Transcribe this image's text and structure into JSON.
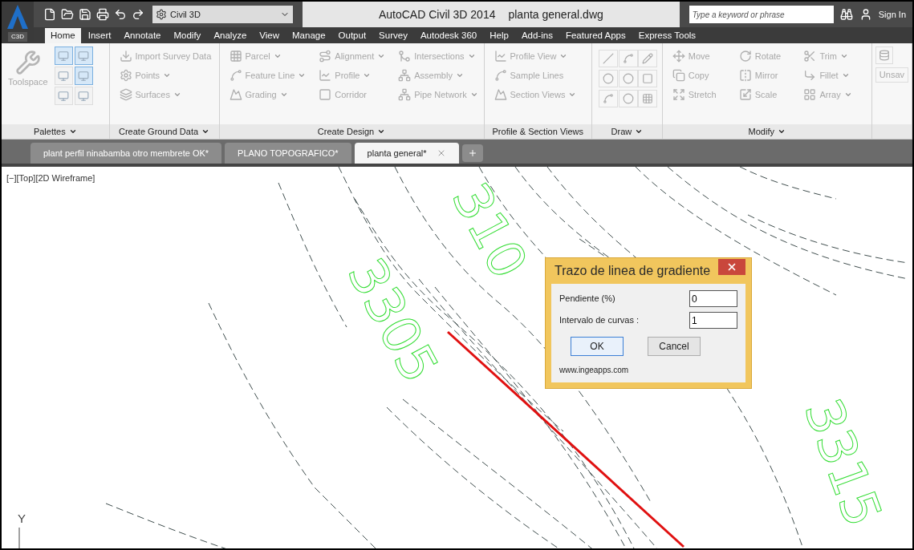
{
  "app": {
    "badge": "C3D"
  },
  "title_bar": {
    "workspace": "Civil 3D",
    "title": "AutoCAD Civil 3D 2014",
    "file": "planta general.dwg",
    "search": {
      "placeholder": "Type a keyword or phrase"
    },
    "sign_in": "Sign In"
  },
  "ribbon_tabs": [
    {
      "label": "Home",
      "selected": true
    },
    {
      "label": "Insert",
      "selected": false
    },
    {
      "label": "Annotate",
      "selected": false
    },
    {
      "label": "Modify",
      "selected": false
    },
    {
      "label": "Analyze",
      "selected": false
    },
    {
      "label": "View",
      "selected": false
    },
    {
      "label": "Manage",
      "selected": false
    },
    {
      "label": "Output",
      "selected": false
    },
    {
      "label": "Survey",
      "selected": false
    },
    {
      "label": "Autodesk 360",
      "selected": false
    },
    {
      "label": "Help",
      "selected": false
    },
    {
      "label": "Add-ins",
      "selected": false
    },
    {
      "label": "Featured Apps",
      "selected": false
    },
    {
      "label": "Express Tools",
      "selected": false
    }
  ],
  "ribbon_panels": [
    {
      "kind": "palettes",
      "title": "Palettes",
      "dropdown": true,
      "tools": [
        {
          "label": "Toolspace"
        }
      ]
    },
    {
      "kind": "list",
      "title": "Create Ground Data",
      "dropdown": true,
      "tools": [
        {
          "label": "Import Survey Data",
          "dropdown": false
        },
        {
          "label": "Points",
          "dropdown": true
        },
        {
          "label": "Surfaces",
          "dropdown": true
        }
      ]
    },
    {
      "kind": "list",
      "title": "Create Design",
      "dropdown": true,
      "tools": [
        {
          "label": "Parcel",
          "dropdown": true
        },
        {
          "label": "Feature Line",
          "dropdown": true
        },
        {
          "label": "Grading",
          "dropdown": true
        },
        {
          "label": "Alignment",
          "dropdown": true
        },
        {
          "label": "Profile",
          "dropdown": true
        },
        {
          "label": "Corridor",
          "dropdown": false
        },
        {
          "label": "Intersections",
          "dropdown": true
        },
        {
          "label": "Assembly",
          "dropdown": true
        },
        {
          "label": "Pipe Network",
          "dropdown": true
        }
      ]
    },
    {
      "kind": "list",
      "title": "Profile & Section Views",
      "dropdown": false,
      "tools": [
        {
          "label": "Profile View",
          "dropdown": true
        },
        {
          "label": "Sample Lines",
          "dropdown": false
        },
        {
          "label": "Section Views",
          "dropdown": true
        }
      ]
    },
    {
      "kind": "draw",
      "title": "Draw",
      "dropdown": true
    },
    {
      "kind": "list",
      "title": "Modify",
      "dropdown": true,
      "tools": [
        {
          "label": "Move",
          "dropdown": false
        },
        {
          "label": "Copy",
          "dropdown": false
        },
        {
          "label": "Stretch",
          "dropdown": false
        },
        {
          "label": "Rotate",
          "dropdown": false
        },
        {
          "label": "Mirror",
          "dropdown": false
        },
        {
          "label": "Scale",
          "dropdown": false
        },
        {
          "label": "Trim",
          "dropdown": true
        },
        {
          "label": "Fillet",
          "dropdown": true
        },
        {
          "label": "Array",
          "dropdown": true
        }
      ]
    },
    {
      "kind": "cut",
      "tools": [
        {
          "label": "Unsav"
        }
      ]
    }
  ],
  "doc_tabs": [
    {
      "label": "plant perfil ninabamba otro membrete OK*",
      "selected": false
    },
    {
      "label": "PLANO TOPOGRAFICO*",
      "selected": false
    },
    {
      "label": "planta general*",
      "selected": true
    }
  ],
  "viewport": {
    "label": "[−][Top][2D Wireframe]",
    "contour_labels": [
      "3305",
      "310",
      "3315"
    ],
    "axis_label": "Y"
  },
  "dialog": {
    "title": "Trazo de linea de gradiente",
    "fields": [
      {
        "label": "Pendiente (%)",
        "value": "0"
      },
      {
        "label": "Intervalo de curvas :",
        "value": "1"
      }
    ],
    "buttons": [
      {
        "label": "OK",
        "default": true
      },
      {
        "label": "Cancel",
        "default": false
      }
    ],
    "footer": "www.ingeapps.com"
  }
}
